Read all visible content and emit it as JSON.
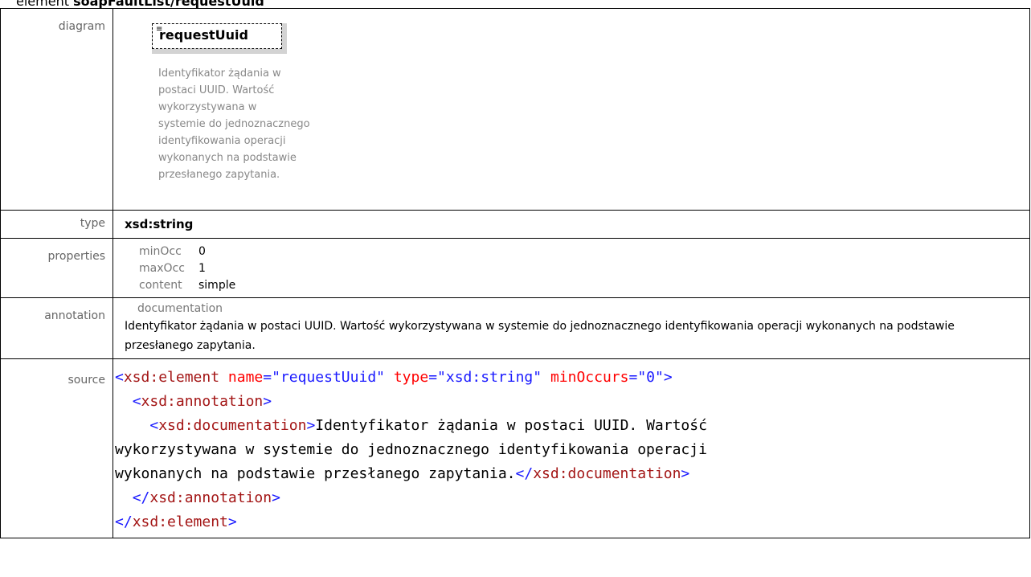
{
  "heading": {
    "prefix": "element ",
    "name": "soapFaultList/requestUuid"
  },
  "labels": {
    "diagram": "diagram",
    "type": "type",
    "properties": "properties",
    "annotation": "annotation",
    "source": "source"
  },
  "diagram": {
    "element_name": "requestUuid",
    "description_lines": [
      "Identyfikator żądania w",
      "postaci UUID. Wartość",
      "wykorzystywana w",
      "systemie do jednoznacznego",
      "identyfikowania operacji",
      "wykonanych na podstawie",
      "przesłanego zapytania."
    ]
  },
  "type": "xsd:string",
  "properties": [
    {
      "key": "minOcc",
      "value": "0"
    },
    {
      "key": "maxOcc",
      "value": "1"
    },
    {
      "key": "content",
      "value": "simple"
    }
  ],
  "annotation": {
    "title": "documentation",
    "text": "Identyfikator żądania w postaci UUID. Wartość wykorzystywana w systemie do jednoznacznego identyfikowania operacji wykonanych na podstawie przesłanego zapytania."
  },
  "source": {
    "line1": {
      "open": "<",
      "tag": "xsd:element",
      "a1": "name",
      "v1": "\"requestUuid\"",
      "a2": "type",
      "v2": "\"xsd:string\"",
      "a3": "minOccurs",
      "v3": "\"0\"",
      "close": ">"
    },
    "line2": {
      "open": "<",
      "tag": "xsd:annotation",
      "close": ">"
    },
    "line3": {
      "open": "<",
      "tag": "xsd:documentation",
      "close": ">",
      "text": "Identyfikator żądania w postaci UUID. Wartość"
    },
    "line4": {
      "text": "wykorzystywana w systemie do jednoznacznego identyfikowania operacji"
    },
    "line5": {
      "text": "wykonanych na podstawie przesłanego zapytania.",
      "open": "</",
      "tag": "xsd:documentation",
      "close": ">"
    },
    "line6": {
      "open": "</",
      "tag": "xsd:annotation",
      "close": ">"
    },
    "line7": {
      "open": "</",
      "tag": "xsd:element",
      "close": ">"
    }
  }
}
